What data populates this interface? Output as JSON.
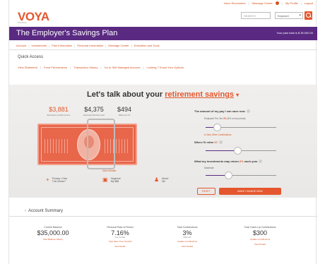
{
  "util_bar": {
    "items": [
      "Voice Recoveries",
      "Message Center",
      "My Profile",
      "Logout"
    ]
  },
  "brand": {
    "logo": "VOYA",
    "logo_sub": "FINANCIAL"
  },
  "search": {
    "placeholder": "SEARCH",
    "scope": "Keyword"
  },
  "plan": {
    "title": "The Employer's Savings Plan",
    "total": "Your plan total is $ 35,000.00"
  },
  "nav": [
    "Account",
    "Investments",
    "Plan Information",
    "Personal Information",
    "Message Center",
    "Education and Tools"
  ],
  "quick_access": {
    "title": "Quick Access",
    "links": [
      "View Statement",
      "Fund Performance",
      "Transaction History",
      "Go to Self Managed Account",
      "Looking 7 Know Your Options"
    ]
  },
  "hero": {
    "prefix": "Let's talk about your",
    "topic": "retirement savings",
    "stats": [
      {
        "value": "$3,881",
        "label": "Estimated monthly income"
      },
      {
        "value": "$4,375",
        "label": "Estimated Monthly Goal"
      },
      {
        "value": "$494",
        "label": "Difference Of"
      }
    ],
    "view_details": "View Details",
    "actions": [
      {
        "icon": "+",
        "label_1": "Privacy / How",
        "label_2": "This Works?"
      },
      {
        "icon": "▣",
        "label_1": "Organize",
        "label_2": "My $$$"
      },
      {
        "icon": "♟",
        "label_1": "About",
        "label_2": "Me"
      }
    ]
  },
  "controls": {
    "save": {
      "label": "The amount of my pay I can save now",
      "sub_prefix": "Employee Pre-Tax",
      "value": "3%",
      "sub_suffix": "(5% on tax period)",
      "link": "& View Other Contributions",
      "level": 0.16
    },
    "retire": {
      "label": "When I'll retire",
      "value": "67",
      "level": 0.45
    },
    "return": {
      "label": "What my investments may return",
      "value": "6%",
      "suffix": "each year",
      "sub": "Moderate",
      "level": 0.32
    },
    "reset": "RESET",
    "make_change": "MAKE CHANGE NOW"
  },
  "account_summary": {
    "title": "Account Summary",
    "metrics": [
      {
        "label": "Current Balance",
        "value": "$35,000.00",
        "sub": "",
        "link_1": "View Balance History",
        "link_2": ""
      },
      {
        "label": "Personal Rate of Return",
        "value": "7.16%",
        "sub": "Year-To-Date",
        "link_1": "View More Time Periods",
        "link_2": "See Details"
      },
      {
        "label": "Total Contributions",
        "value": "3%",
        "sub": "PRE-TAX",
        "link_1": "Update Contributions",
        "link_2": "View Details"
      },
      {
        "label": "Total Catch-Up Contributions",
        "value": "$300",
        "sub": "",
        "link_1": "Update Contributions",
        "link_2": "View Details"
      }
    ]
  }
}
